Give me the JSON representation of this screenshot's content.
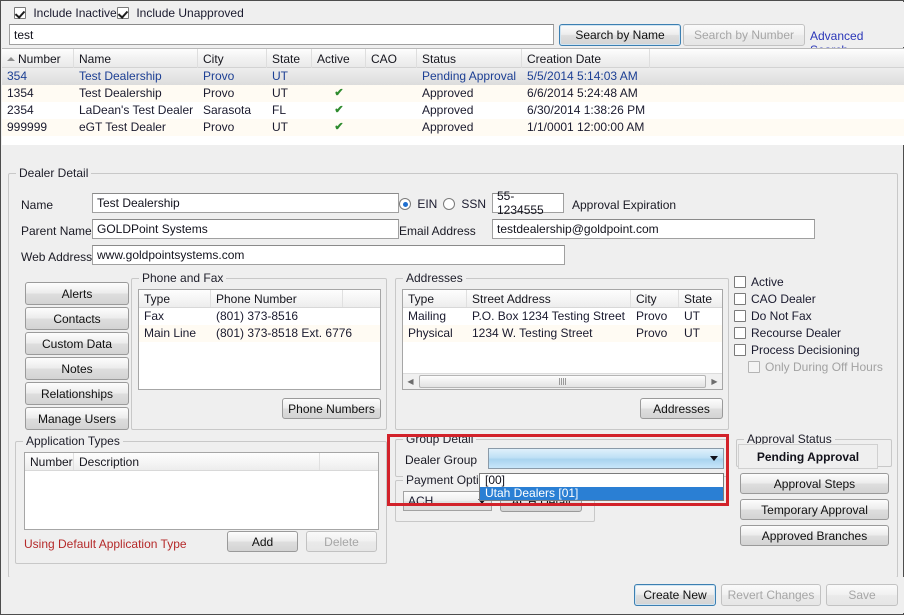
{
  "search": {
    "include_inactive_label": "Include Inactive",
    "include_inactive_checked": true,
    "include_unapproved_label": "Include Unapproved",
    "include_unapproved_checked": true,
    "query_value": "test",
    "query_placeholder": "",
    "search_by_name_label": "Search by Name",
    "search_by_number_label": "Search by Number",
    "advanced_search_label": "Advanced Search"
  },
  "results": {
    "columns": [
      "Number",
      "Name",
      "City",
      "State",
      "Active",
      "CAO",
      "Status",
      "Creation Date"
    ],
    "sorted_column": "Number",
    "rows": [
      {
        "number": "354",
        "name": "Test Dealership",
        "city": "Provo",
        "state": "UT",
        "active": "",
        "cao": "",
        "status": "Pending Approval",
        "creation_date": "5/5/2014 5:14:03 AM",
        "selected": true
      },
      {
        "number": "1354",
        "name": "Test Dealership",
        "city": "Provo",
        "state": "UT",
        "active": "✔",
        "cao": "",
        "status": "Approved",
        "creation_date": "6/6/2014 5:24:48 AM",
        "selected": false
      },
      {
        "number": "2354",
        "name": "LaDean's Test Dealer",
        "city": "Sarasota",
        "state": "FL",
        "active": "✔",
        "cao": "",
        "status": "Approved",
        "creation_date": "6/30/2014 1:38:26 PM",
        "selected": false
      },
      {
        "number": "999999",
        "name": "eGT Test Dealer",
        "city": "Provo",
        "state": "UT",
        "active": "✔",
        "cao": "",
        "status": "Approved",
        "creation_date": "1/1/0001 12:00:00 AM",
        "selected": false
      }
    ]
  },
  "detail": {
    "title": "Dealer Detail",
    "name_label": "Name",
    "name_value": "Test Dealership",
    "parent_name_label": "Parent Name",
    "parent_name_value": "GOLDPoint Systems",
    "web_address_label": "Web Address",
    "web_address_value": "www.goldpointsystems.com",
    "ein_label": "EIN",
    "ssn_label": "SSN",
    "tax_id_selected": "EIN",
    "tax_id_value": "55-1234555",
    "approval_expiration_label": "Approval Expiration",
    "email_label": "Email Address",
    "email_value": "testdealership@goldpoint.com"
  },
  "side_buttons": [
    {
      "label": "Alerts"
    },
    {
      "label": "Contacts"
    },
    {
      "label": "Custom Data"
    },
    {
      "label": "Notes"
    },
    {
      "label": "Relationships"
    },
    {
      "label": "Manage Users"
    }
  ],
  "phone_and_fax": {
    "title": "Phone and Fax",
    "columns": [
      "Type",
      "Phone Number"
    ],
    "rows": [
      {
        "type": "Fax",
        "number": "(801) 373-8516"
      },
      {
        "type": "Main Line",
        "number": "(801) 373-8518 Ext. 6776"
      }
    ],
    "button_label": "Phone Numbers"
  },
  "addresses": {
    "title": "Addresses",
    "columns": [
      "Type",
      "Street Address",
      "City",
      "State"
    ],
    "rows": [
      {
        "type": "Mailing",
        "street": "P.O. Box 1234 Testing Street",
        "city": "Provo",
        "state": "UT"
      },
      {
        "type": "Physical",
        "street": "1234 W. Testing Street",
        "city": "Provo",
        "state": "UT"
      }
    ],
    "button_label": "Addresses"
  },
  "flags": [
    {
      "label": "Active",
      "checked": false,
      "disabled": false
    },
    {
      "label": "CAO Dealer",
      "checked": false,
      "disabled": false
    },
    {
      "label": "Do Not Fax",
      "checked": false,
      "disabled": false
    },
    {
      "label": "Recourse Dealer",
      "checked": false,
      "disabled": false
    },
    {
      "label": "Process Decisioning",
      "checked": false,
      "disabled": false
    },
    {
      "label": "Only During Off Hours",
      "checked": false,
      "disabled": true
    }
  ],
  "application_types": {
    "title": "Application Types",
    "columns": [
      "Number",
      "Description"
    ],
    "rows": [],
    "note": "Using Default Application Type",
    "add_label": "Add",
    "delete_label": "Delete"
  },
  "group_detail": {
    "title": "Group Detail",
    "dealer_group_label": "Dealer Group",
    "dealer_group_value": "",
    "dropdown_open": true,
    "dropdown_options": [
      "[00]",
      "Utah Dealers [01]"
    ],
    "dropdown_highlighted": "Utah Dealers [01]",
    "highlight_color": "#d2222a"
  },
  "payment_option": {
    "title": "Payment Option",
    "value": "ACH",
    "detail_button_label": "ACH Detail"
  },
  "approval": {
    "title": "Approval Status",
    "status": "Pending Approval",
    "buttons": [
      {
        "label": "Approval Steps"
      },
      {
        "label": "Temporary Approval"
      },
      {
        "label": "Approved Branches"
      }
    ]
  },
  "footer": {
    "create_new_label": "Create New",
    "revert_changes_label": "Revert Changes",
    "save_label": "Save"
  }
}
